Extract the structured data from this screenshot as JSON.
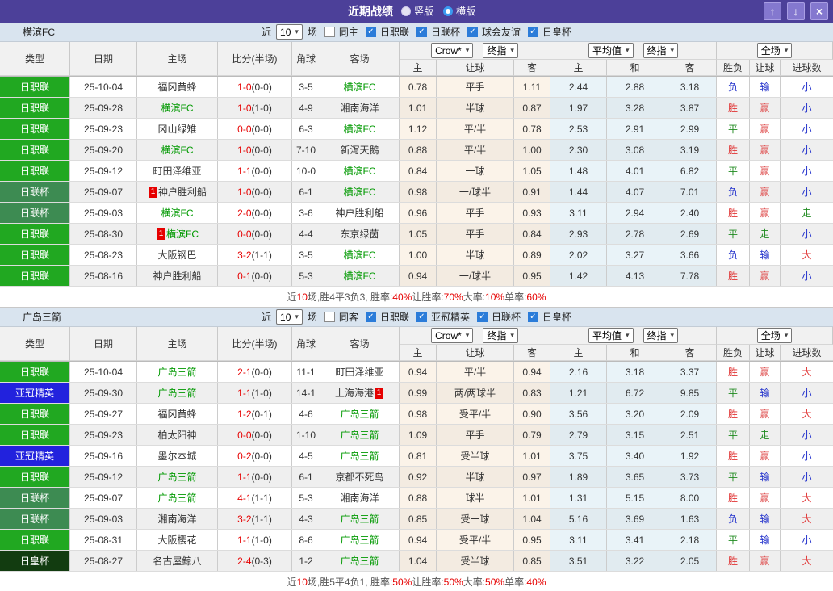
{
  "titlebar": {
    "title": "近期战绩",
    "radios": [
      {
        "label": "竖版",
        "selected": false
      },
      {
        "label": "横版",
        "selected": true
      }
    ]
  },
  "icons": {
    "up_arrow": "↑",
    "down_arrow": "↓",
    "close": "×",
    "caret_down": "▾",
    "check": "✓"
  },
  "colors": {
    "titlebar_bg": "#4c4099",
    "window_button_bg": "#8478cf",
    "focus_team": "#009900",
    "score_red": "#e60000",
    "summary_red": "#e60000",
    "league": {
      "日职联": "#21a821",
      "日联杯": "#3d8b52",
      "亚冠精英": "#2222dd",
      "日皇杯": "#123c10",
      "球会友谊": "#3d8b52"
    },
    "result": {
      "胜": "#e03434",
      "赢": "#e05555",
      "大": "#e03434",
      "平": "#1f8a1f",
      "走": "#1f8a1f",
      "负": "#2433cc",
      "输": "#2433cc",
      "小": "#2433cc"
    }
  },
  "filter_labels": {
    "near": "近",
    "games": "场"
  },
  "table": {
    "main_headers": [
      "类型",
      "日期",
      "主场",
      "比分(半场)",
      "角球",
      "客场"
    ],
    "group1_dropdowns": [
      "Crow*",
      "终指"
    ],
    "group2_dropdowns": [
      "平均值",
      "终指"
    ],
    "group3_dropdowns": [
      "全场"
    ],
    "sub_headers": [
      "主",
      "让球",
      "客",
      "主",
      "和",
      "客",
      "胜负",
      "让球",
      "进球数"
    ]
  },
  "sections": [
    {
      "team": "横滨FC",
      "filter": {
        "count": "10",
        "same_label": "同主",
        "same_checked": false,
        "competitions": [
          {
            "label": "日职联",
            "checked": true
          },
          {
            "label": "日联杯",
            "checked": true
          },
          {
            "label": "球会友谊",
            "checked": true
          },
          {
            "label": "日皇杯",
            "checked": true
          }
        ]
      },
      "rows": [
        {
          "league": "日职联",
          "date": "25-10-04",
          "home": "福冈黄蜂",
          "home_focus": false,
          "home_card": null,
          "score": "1-0",
          "half": "(0-0)",
          "corner": "3-5",
          "away": "横滨FC",
          "away_focus": true,
          "away_card": null,
          "odds": [
            "0.78",
            "平手",
            "1.11",
            "2.44",
            "2.88",
            "3.18"
          ],
          "results": [
            "负",
            "输",
            "小"
          ]
        },
        {
          "league": "日职联",
          "date": "25-09-28",
          "home": "横滨FC",
          "home_focus": true,
          "home_card": null,
          "score": "1-0",
          "half": "(1-0)",
          "corner": "4-9",
          "away": "湘南海洋",
          "away_focus": false,
          "away_card": null,
          "odds": [
            "1.01",
            "半球",
            "0.87",
            "1.97",
            "3.28",
            "3.87"
          ],
          "results": [
            "胜",
            "赢",
            "小"
          ]
        },
        {
          "league": "日职联",
          "date": "25-09-23",
          "home": "冈山绿雉",
          "home_focus": false,
          "home_card": null,
          "score": "0-0",
          "half": "(0-0)",
          "corner": "6-3",
          "away": "横滨FC",
          "away_focus": true,
          "away_card": null,
          "odds": [
            "1.12",
            "平/半",
            "0.78",
            "2.53",
            "2.91",
            "2.99"
          ],
          "results": [
            "平",
            "赢",
            "小"
          ]
        },
        {
          "league": "日职联",
          "date": "25-09-20",
          "home": "横滨FC",
          "home_focus": true,
          "home_card": null,
          "score": "1-0",
          "half": "(0-0)",
          "corner": "7-10",
          "away": "新泻天鹅",
          "away_focus": false,
          "away_card": null,
          "odds": [
            "0.88",
            "平/半",
            "1.00",
            "2.30",
            "3.08",
            "3.19"
          ],
          "results": [
            "胜",
            "赢",
            "小"
          ]
        },
        {
          "league": "日职联",
          "date": "25-09-12",
          "home": "町田泽维亚",
          "home_focus": false,
          "home_card": null,
          "score": "1-1",
          "half": "(0-0)",
          "corner": "10-0",
          "away": "横滨FC",
          "away_focus": true,
          "away_card": null,
          "odds": [
            "0.84",
            "一球",
            "1.05",
            "1.48",
            "4.01",
            "6.82"
          ],
          "results": [
            "平",
            "赢",
            "小"
          ]
        },
        {
          "league": "日联杯",
          "date": "25-09-07",
          "home": "神户胜利船",
          "home_focus": false,
          "home_card": "1",
          "score": "1-0",
          "half": "(0-0)",
          "corner": "6-1",
          "away": "横滨FC",
          "away_focus": true,
          "away_card": null,
          "odds": [
            "0.98",
            "一/球半",
            "0.91",
            "1.44",
            "4.07",
            "7.01"
          ],
          "results": [
            "负",
            "赢",
            "小"
          ]
        },
        {
          "league": "日联杯",
          "date": "25-09-03",
          "home": "横滨FC",
          "home_focus": true,
          "home_card": null,
          "score": "2-0",
          "half": "(0-0)",
          "corner": "3-6",
          "away": "神户胜利船",
          "away_focus": false,
          "away_card": null,
          "odds": [
            "0.96",
            "平手",
            "0.93",
            "3.11",
            "2.94",
            "2.40"
          ],
          "results": [
            "胜",
            "赢",
            "走"
          ]
        },
        {
          "league": "日职联",
          "date": "25-08-30",
          "home": "横滨FC",
          "home_focus": true,
          "home_card": "1",
          "score": "0-0",
          "half": "(0-0)",
          "corner": "4-4",
          "away": "东京绿茵",
          "away_focus": false,
          "away_card": null,
          "odds": [
            "1.05",
            "平手",
            "0.84",
            "2.93",
            "2.78",
            "2.69"
          ],
          "results": [
            "平",
            "走",
            "小"
          ]
        },
        {
          "league": "日职联",
          "date": "25-08-23",
          "home": "大阪钢巴",
          "home_focus": false,
          "home_card": null,
          "score": "3-2",
          "half": "(1-1)",
          "corner": "3-5",
          "away": "横滨FC",
          "away_focus": true,
          "away_card": null,
          "odds": [
            "1.00",
            "半球",
            "0.89",
            "2.02",
            "3.27",
            "3.66"
          ],
          "results": [
            "负",
            "输",
            "大"
          ]
        },
        {
          "league": "日职联",
          "date": "25-08-16",
          "home": "神户胜利船",
          "home_focus": false,
          "home_card": null,
          "score": "0-1",
          "half": "(0-0)",
          "corner": "5-3",
          "away": "横滨FC",
          "away_focus": true,
          "away_card": null,
          "odds": [
            "0.94",
            "一/球半",
            "0.95",
            "1.42",
            "4.13",
            "7.78"
          ],
          "results": [
            "胜",
            "赢",
            "小"
          ]
        }
      ],
      "summary": [
        [
          "近",
          "n"
        ],
        [
          "10",
          "r"
        ],
        [
          "场,胜4平3负3, 胜率:",
          "n"
        ],
        [
          "40%",
          "r"
        ],
        [
          " 让胜率:",
          "n"
        ],
        [
          "70%",
          "r"
        ],
        [
          " 大率:",
          "n"
        ],
        [
          "10%",
          "r"
        ],
        [
          " 单率:",
          "n"
        ],
        [
          "60%",
          "r"
        ]
      ]
    },
    {
      "team": "广岛三箭",
      "filter": {
        "count": "10",
        "same_label": "同客",
        "same_checked": false,
        "competitions": [
          {
            "label": "日职联",
            "checked": true
          },
          {
            "label": "亚冠精英",
            "checked": true
          },
          {
            "label": "日联杯",
            "checked": true
          },
          {
            "label": "日皇杯",
            "checked": true
          }
        ]
      },
      "rows": [
        {
          "league": "日职联",
          "date": "25-10-04",
          "home": "广岛三箭",
          "home_focus": true,
          "home_card": null,
          "score": "2-1",
          "half": "(0-0)",
          "corner": "11-1",
          "away": "町田泽维亚",
          "away_focus": false,
          "away_card": null,
          "odds": [
            "0.94",
            "平/半",
            "0.94",
            "2.16",
            "3.18",
            "3.37"
          ],
          "results": [
            "胜",
            "赢",
            "大"
          ]
        },
        {
          "league": "亚冠精英",
          "date": "25-09-30",
          "home": "广岛三箭",
          "home_focus": true,
          "home_card": null,
          "score": "1-1",
          "half": "(1-0)",
          "corner": "14-1",
          "away": "上海海港",
          "away_focus": false,
          "away_card": "1",
          "odds": [
            "0.99",
            "两/两球半",
            "0.83",
            "1.21",
            "6.72",
            "9.85"
          ],
          "results": [
            "平",
            "输",
            "小"
          ]
        },
        {
          "league": "日职联",
          "date": "25-09-27",
          "home": "福冈黄蜂",
          "home_focus": false,
          "home_card": null,
          "score": "1-2",
          "half": "(0-1)",
          "corner": "4-6",
          "away": "广岛三箭",
          "away_focus": true,
          "away_card": null,
          "odds": [
            "0.98",
            "受平/半",
            "0.90",
            "3.56",
            "3.20",
            "2.09"
          ],
          "results": [
            "胜",
            "赢",
            "大"
          ]
        },
        {
          "league": "日职联",
          "date": "25-09-23",
          "home": "柏太阳神",
          "home_focus": false,
          "home_card": null,
          "score": "0-0",
          "half": "(0-0)",
          "corner": "1-10",
          "away": "广岛三箭",
          "away_focus": true,
          "away_card": null,
          "odds": [
            "1.09",
            "平手",
            "0.79",
            "2.79",
            "3.15",
            "2.51"
          ],
          "results": [
            "平",
            "走",
            "小"
          ]
        },
        {
          "league": "亚冠精英",
          "date": "25-09-16",
          "home": "墨尔本城",
          "home_focus": false,
          "home_card": null,
          "score": "0-2",
          "half": "(0-0)",
          "corner": "4-5",
          "away": "广岛三箭",
          "away_focus": true,
          "away_card": null,
          "odds": [
            "0.81",
            "受半球",
            "1.01",
            "3.75",
            "3.40",
            "1.92"
          ],
          "results": [
            "胜",
            "赢",
            "小"
          ]
        },
        {
          "league": "日职联",
          "date": "25-09-12",
          "home": "广岛三箭",
          "home_focus": true,
          "home_card": null,
          "score": "1-1",
          "half": "(0-0)",
          "corner": "6-1",
          "away": "京都不死鸟",
          "away_focus": false,
          "away_card": null,
          "odds": [
            "0.92",
            "半球",
            "0.97",
            "1.89",
            "3.65",
            "3.73"
          ],
          "results": [
            "平",
            "输",
            "小"
          ]
        },
        {
          "league": "日联杯",
          "date": "25-09-07",
          "home": "广岛三箭",
          "home_focus": true,
          "home_card": null,
          "score": "4-1",
          "half": "(1-1)",
          "corner": "5-3",
          "away": "湘南海洋",
          "away_focus": false,
          "away_card": null,
          "odds": [
            "0.88",
            "球半",
            "1.01",
            "1.31",
            "5.15",
            "8.00"
          ],
          "results": [
            "胜",
            "赢",
            "大"
          ]
        },
        {
          "league": "日联杯",
          "date": "25-09-03",
          "home": "湘南海洋",
          "home_focus": false,
          "home_card": null,
          "score": "3-2",
          "half": "(1-1)",
          "corner": "4-3",
          "away": "广岛三箭",
          "away_focus": true,
          "away_card": null,
          "odds": [
            "0.85",
            "受一球",
            "1.04",
            "5.16",
            "3.69",
            "1.63"
          ],
          "results": [
            "负",
            "输",
            "大"
          ]
        },
        {
          "league": "日职联",
          "date": "25-08-31",
          "home": "大阪樱花",
          "home_focus": false,
          "home_card": null,
          "score": "1-1",
          "half": "(1-0)",
          "corner": "8-6",
          "away": "广岛三箭",
          "away_focus": true,
          "away_card": null,
          "odds": [
            "0.94",
            "受平/半",
            "0.95",
            "3.11",
            "3.41",
            "2.18"
          ],
          "results": [
            "平",
            "输",
            "小"
          ]
        },
        {
          "league": "日皇杯",
          "date": "25-08-27",
          "home": "名古屋鲸八",
          "home_focus": false,
          "home_card": null,
          "score": "2-4",
          "half": "(0-3)",
          "corner": "1-2",
          "away": "广岛三箭",
          "away_focus": true,
          "away_card": null,
          "odds": [
            "1.04",
            "受半球",
            "0.85",
            "3.51",
            "3.22",
            "2.05"
          ],
          "results": [
            "胜",
            "赢",
            "大"
          ]
        }
      ],
      "summary": [
        [
          "近",
          "n"
        ],
        [
          "10",
          "r"
        ],
        [
          "场,胜5平4负1, 胜率:",
          "n"
        ],
        [
          "50%",
          "r"
        ],
        [
          " 让胜率:",
          "n"
        ],
        [
          "50%",
          "r"
        ],
        [
          " 大率:",
          "n"
        ],
        [
          "50%",
          "r"
        ],
        [
          " 单率:",
          "n"
        ],
        [
          "40%",
          "r"
        ]
      ]
    }
  ]
}
